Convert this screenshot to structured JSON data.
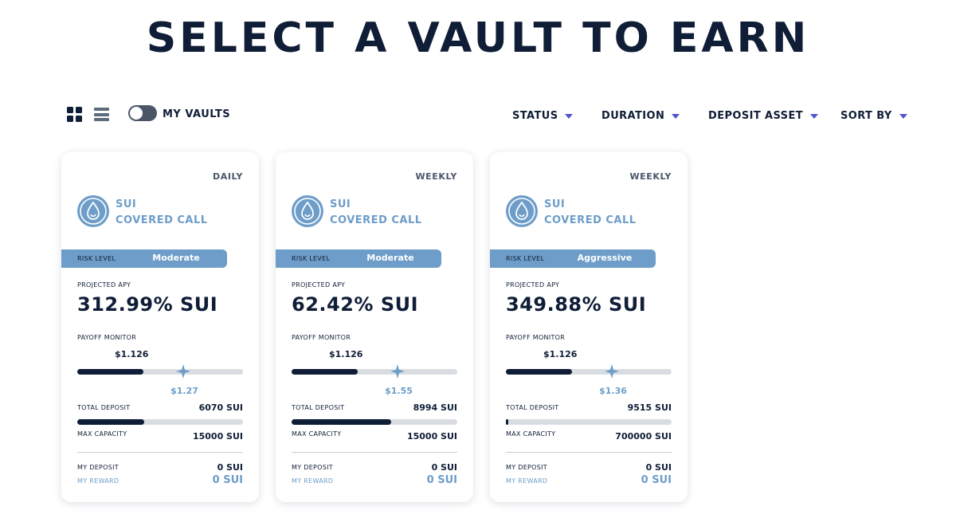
{
  "page": {
    "title": "SELECT A VAULT TO EARN"
  },
  "toolbar": {
    "grid_view_icon": "grid-icon",
    "list_view_icon": "list-icon",
    "my_vaults_label": "MY VAULTS",
    "my_vaults_toggle_on": false,
    "filters": [
      {
        "label": "STATUS"
      },
      {
        "label": "DURATION"
      },
      {
        "label": "DEPOSIT ASSET"
      },
      {
        "label": "SORT BY"
      }
    ]
  },
  "colors": {
    "navy": "#0f1d36",
    "accent_blue": "#6d9dc8",
    "caret": "#4c57c9",
    "track": "#d9dde2"
  },
  "cards": [
    {
      "period": "DAILY",
      "name_line1": "SUI",
      "name_line2": "COVERED CALL",
      "risk_label": "RISK LEVEL",
      "risk_value": "Moderate",
      "apy_label": "PROJECTED APY",
      "apy_value": "312.99% SUI",
      "payoff_label": "PAYOFF MONITOR",
      "current_price": "$1.126",
      "strike_price": "$1.27",
      "payoff_fill": 0.4,
      "strike_position": 0.64,
      "total_deposit_label": "TOTAL DEPOSIT",
      "total_deposit": "6070 SUI",
      "capacity_fill": 0.405,
      "max_capacity_label": "MAX CAPACITY",
      "max_capacity": "15000 SUI",
      "my_deposit_label": "MY DEPOSIT",
      "my_deposit": "0  SUI",
      "my_reward_label": "MY REWARD",
      "my_reward": "0  SUI"
    },
    {
      "period": "WEEKLY",
      "name_line1": "SUI",
      "name_line2": "COVERED CALL",
      "risk_label": "RISK LEVEL",
      "risk_value": "Moderate",
      "apy_label": "PROJECTED APY",
      "apy_value": "62.42% SUI",
      "payoff_label": "PAYOFF MONITOR",
      "current_price": "$1.126",
      "strike_price": "$1.55",
      "payoff_fill": 0.4,
      "strike_position": 0.64,
      "total_deposit_label": "TOTAL DEPOSIT",
      "total_deposit": "8994 SUI",
      "capacity_fill": 0.6,
      "max_capacity_label": "MAX CAPACITY",
      "max_capacity": "15000 SUI",
      "my_deposit_label": "MY DEPOSIT",
      "my_deposit": "0  SUI",
      "my_reward_label": "MY REWARD",
      "my_reward": "0  SUI"
    },
    {
      "period": "WEEKLY",
      "name_line1": "SUI",
      "name_line2": "COVERED CALL",
      "risk_label": "RISK LEVEL",
      "risk_value": "Aggressive",
      "apy_label": "PROJECTED APY",
      "apy_value": "349.88% SUI",
      "payoff_label": "PAYOFF MONITOR",
      "current_price": "$1.126",
      "strike_price": "$1.36",
      "payoff_fill": 0.4,
      "strike_position": 0.64,
      "total_deposit_label": "TOTAL DEPOSIT",
      "total_deposit": "9515 SUI",
      "capacity_fill": 0.0136,
      "max_capacity_label": "MAX CAPACITY",
      "max_capacity": "700000 SUI",
      "my_deposit_label": "MY DEPOSIT",
      "my_deposit": "0  SUI",
      "my_reward_label": "MY REWARD",
      "my_reward": "0  SUI"
    }
  ]
}
